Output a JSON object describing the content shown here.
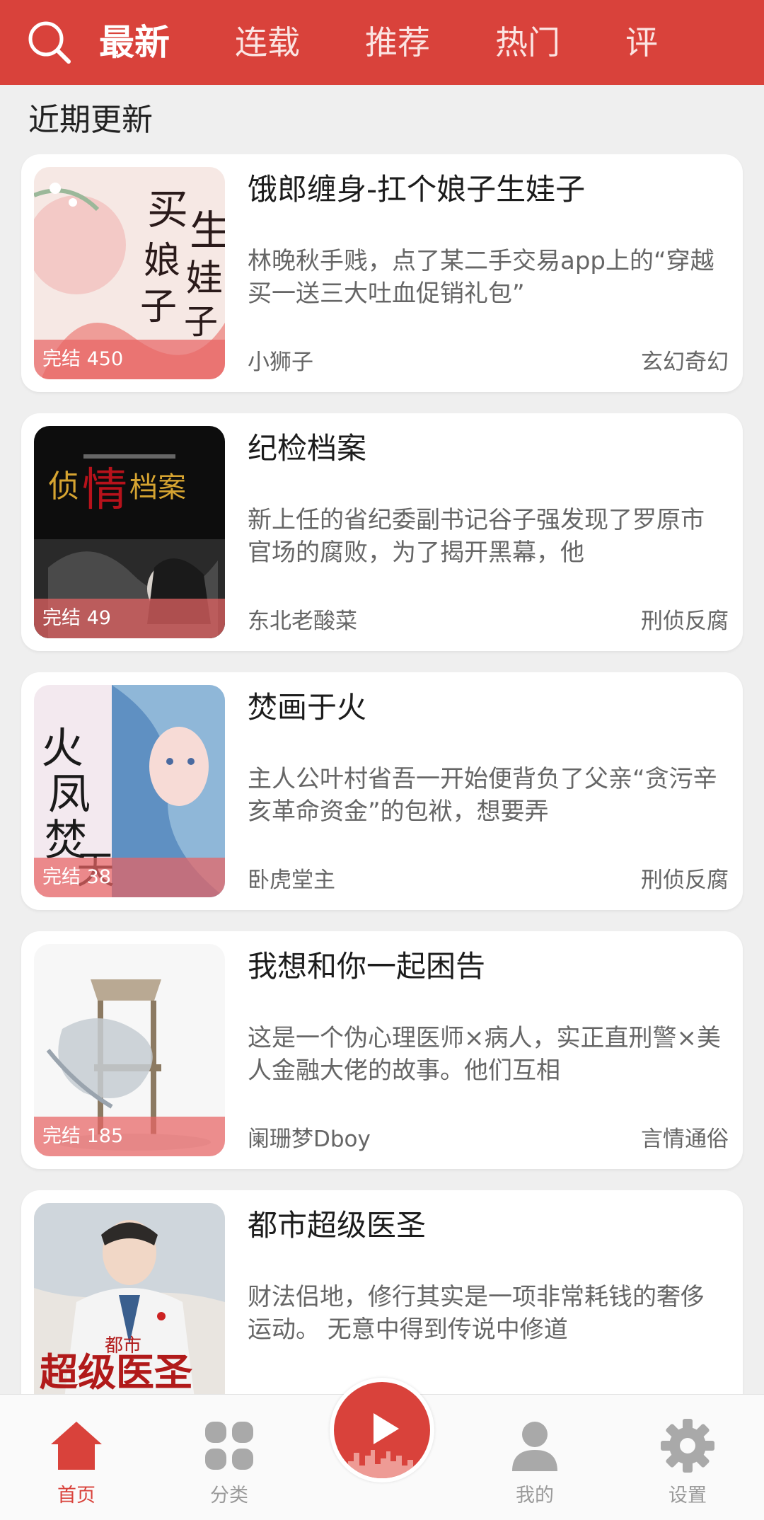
{
  "topbar": {
    "tabs": [
      {
        "label": "最新",
        "active": true
      },
      {
        "label": "连载",
        "active": false
      },
      {
        "label": "推荐",
        "active": false
      },
      {
        "label": "热门",
        "active": false
      },
      {
        "label": "评",
        "active": false
      }
    ],
    "search_icon": "search-icon",
    "accent_color": "#d9423b"
  },
  "section_title": "近期更新",
  "books": [
    {
      "title": "饿郎缠身-扛个娘子生娃子",
      "description": "林晚秋手贱，点了某二手交易app上的“穿越买一送三大吐血促销礼包”",
      "author": "小狮子",
      "genre": "玄幻奇幻",
      "badge": "完结 450"
    },
    {
      "title": "纪检档案",
      "description": "新上任的省纪委副书记谷子强发现了罗原市官场的腐败，为了揭开黑幕，他",
      "author": "东北老酸菜",
      "genre": "刑侦反腐",
      "badge": "完结 49"
    },
    {
      "title": "焚画于火",
      "description": "主人公叶村省吾一开始便背负了父亲“贪污辛亥革命资金”的包袱，想要弄",
      "author": "卧虎堂主",
      "genre": "刑侦反腐",
      "badge": "完结 38"
    },
    {
      "title": "我想和你一起困告",
      "description": "这是一个伪心理医师×病人，实正直刑警×美人金融大佬的故事。他们互相",
      "author": "阑珊梦Dboy",
      "genre": "言情通俗",
      "badge": "完结 185"
    },
    {
      "title": "都市超级医圣",
      "description": "财法侣地，修行其实是一项非常耗钱的奢侈运动。 无意中得到传说中修道",
      "author": "",
      "genre": "",
      "badge": ""
    }
  ],
  "bottom_nav": [
    {
      "label": "首页",
      "icon": "home-icon",
      "active": true
    },
    {
      "label": "分类",
      "icon": "category-grid-icon",
      "active": false
    },
    {
      "label": "我的",
      "icon": "user-icon",
      "active": false
    },
    {
      "label": "设置",
      "icon": "gear-icon",
      "active": false
    }
  ],
  "play_button_icon": "play-icon"
}
